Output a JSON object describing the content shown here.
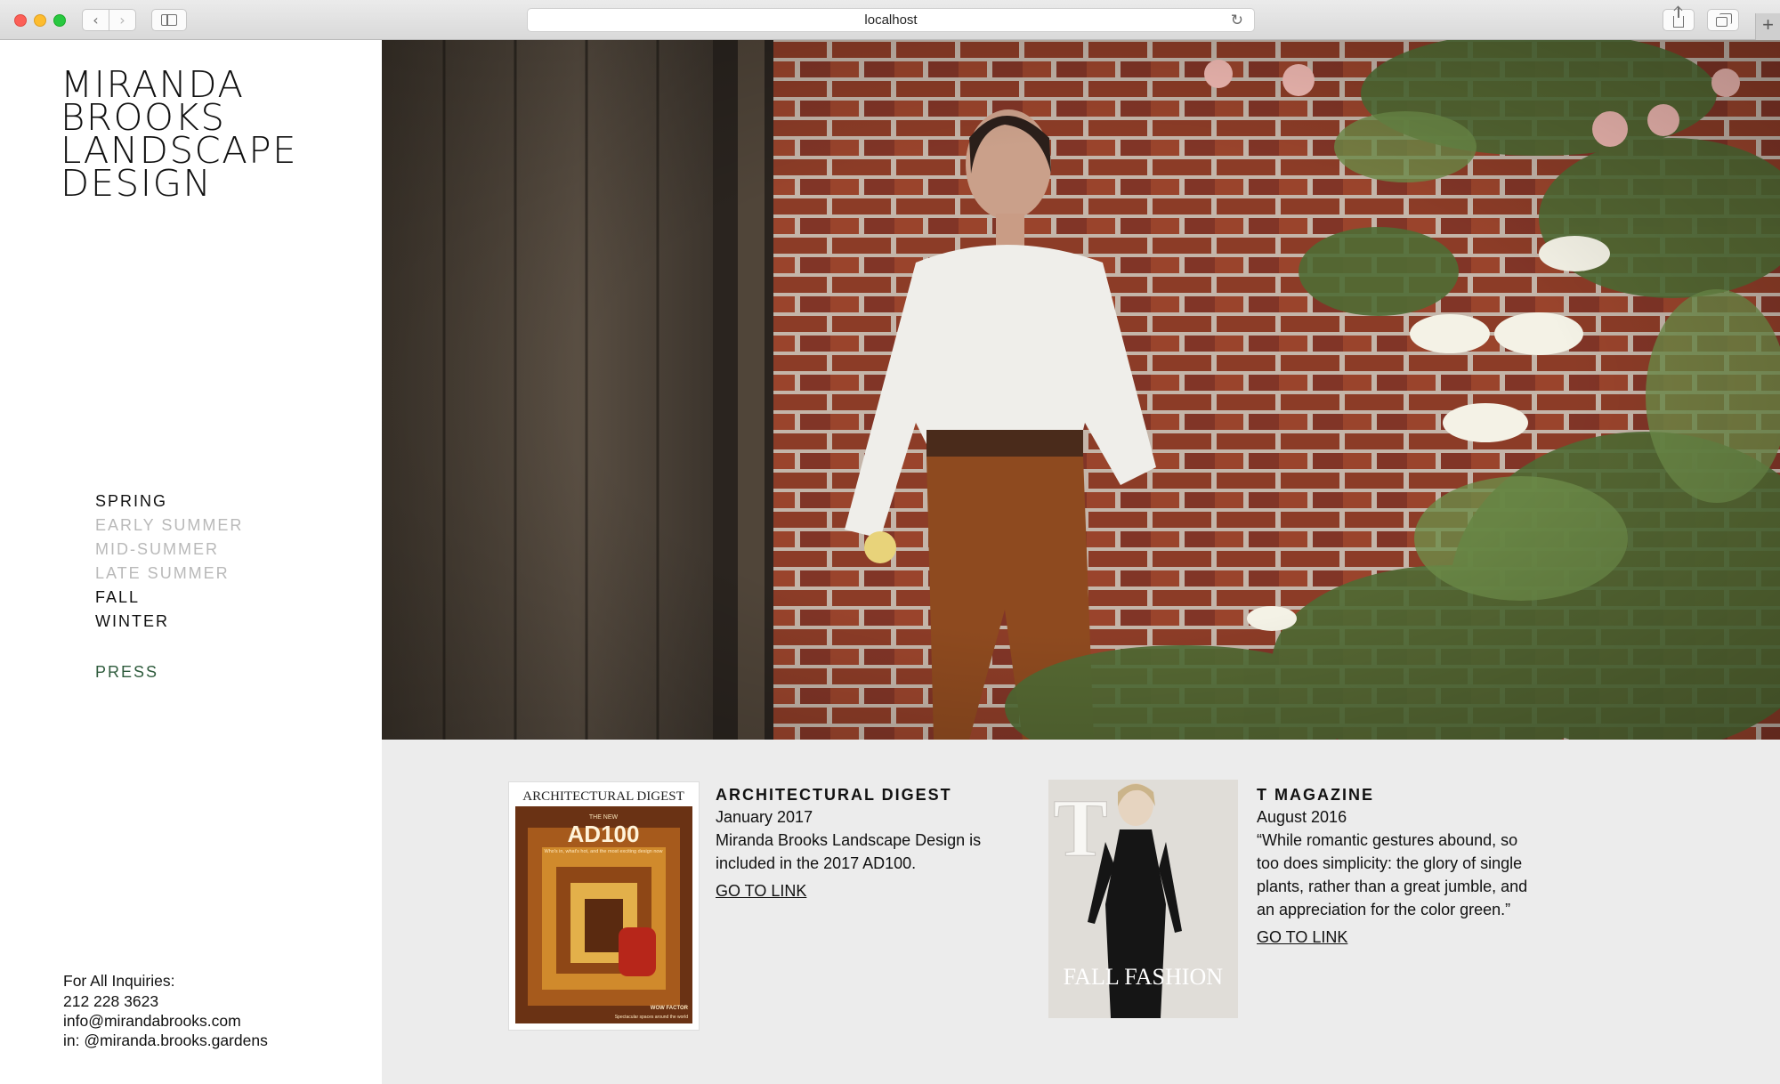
{
  "browser": {
    "url": "localhost",
    "back_glyph": "‹",
    "forward_glyph": "›",
    "reload_glyph": "↻",
    "new_tab_glyph": "+"
  },
  "brand": {
    "lines": [
      "MIRANDA",
      "BROOKS",
      "LANDSCAPE",
      "DESIGN"
    ]
  },
  "nav": {
    "items": [
      {
        "label": "SPRING",
        "active": true
      },
      {
        "label": "EARLY SUMMER",
        "active": false
      },
      {
        "label": "MID-SUMMER",
        "active": false
      },
      {
        "label": "LATE SUMMER",
        "active": false
      },
      {
        "label": "FALL",
        "active": true
      },
      {
        "label": "WINTER",
        "active": true
      }
    ],
    "press_label": "PRESS",
    "press_color": "#2e5b3c"
  },
  "contact": {
    "heading": "For All Inquiries:",
    "phone": "212 228 3623",
    "email": "info@mirandabrooks.com",
    "instagram": "in: @miranda.brooks.gardens"
  },
  "press": [
    {
      "publication": "ARCHITECTURAL DIGEST",
      "date": "January 2017",
      "description": "Miranda Brooks Landscape Design is included in the 2017 AD100.",
      "link_label": "GO TO LINK",
      "cover": {
        "masthead": "ARCHITECTURAL DIGEST",
        "kicker": "THE NEW",
        "headline": "AD100",
        "tagline": "Who's in, what's hot, and the most exciting design now",
        "footer_title": "WOW FACTOR",
        "footer_text": "Spectacular spaces around the world"
      }
    },
    {
      "publication": "T MAGAZINE",
      "date": "August 2016",
      "description": "“While romantic gestures abound, so too does simplicity: the glory of single plants, rather than a great jumble, and an appreciation for the color green.”",
      "link_label": "GO TO LINK",
      "cover": {
        "masthead": "T",
        "headline": "FALL FASHION"
      }
    }
  ],
  "colors": {
    "press_background": "#ececec",
    "brick": "#8e3b24",
    "wood": "#4b4137"
  }
}
